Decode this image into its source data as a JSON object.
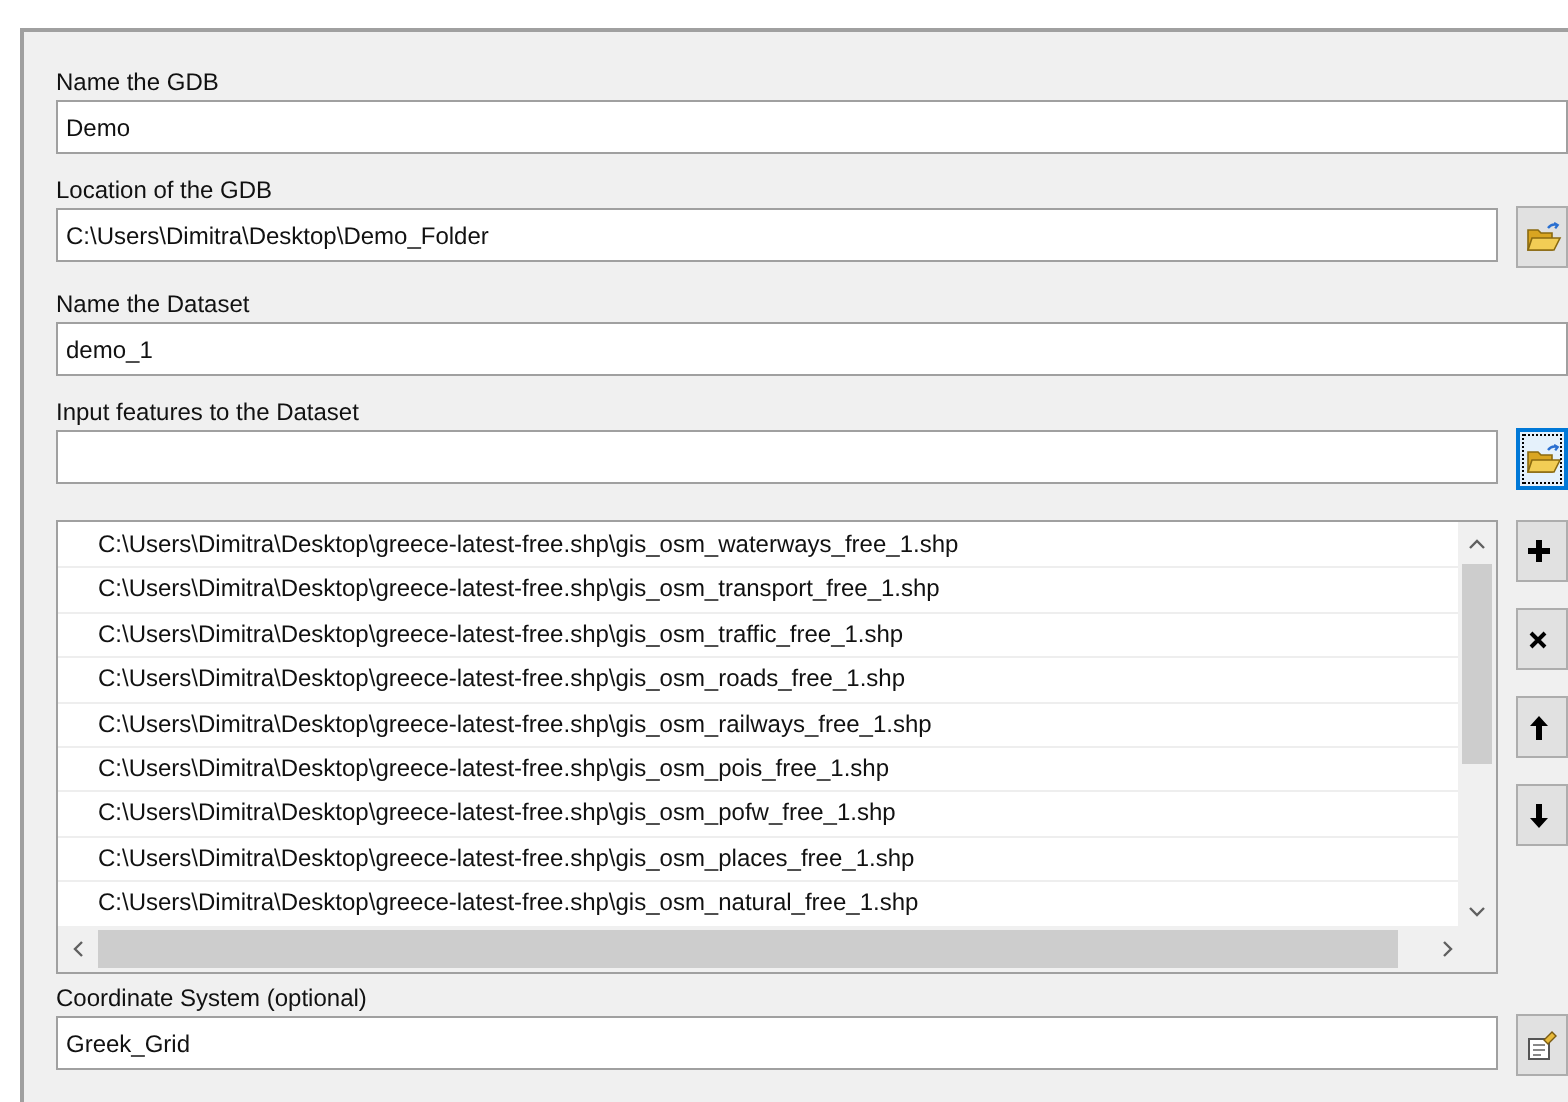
{
  "fields": [
    {
      "label": "Name the GDB",
      "value": "Demo",
      "kind": "text"
    },
    {
      "label": "Location of the GDB",
      "value": "C:\\Users\\Dimitra\\Desktop\\Demo_Folder",
      "kind": "browse",
      "focused": false
    },
    {
      "label": "Name the Dataset",
      "value": "demo_1",
      "kind": "text"
    },
    {
      "label": "Input features to the Dataset",
      "kind": "browse",
      "focused": true
    }
  ],
  "features_list": {
    "items": [
      "C:\\Users\\Dimitra\\Desktop\\greece-latest-free.shp\\gis_osm_waterways_free_1.shp",
      "C:\\Users\\Dimitra\\Desktop\\greece-latest-free.shp\\gis_osm_transport_free_1.shp",
      "C:\\Users\\Dimitra\\Desktop\\greece-latest-free.shp\\gis_osm_traffic_free_1.shp",
      "C:\\Users\\Dimitra\\Desktop\\greece-latest-free.shp\\gis_osm_roads_free_1.shp",
      "C:\\Users\\Dimitra\\Desktop\\greece-latest-free.shp\\gis_osm_railways_free_1.shp",
      "C:\\Users\\Dimitra\\Desktop\\greece-latest-free.shp\\gis_osm_pois_free_1.shp",
      "C:\\Users\\Dimitra\\Desktop\\greece-latest-free.shp\\gis_osm_pofw_free_1.shp",
      "C:\\Users\\Dimitra\\Desktop\\greece-latest-free.shp\\gis_osm_places_free_1.shp",
      "C:\\Users\\Dimitra\\Desktop\\greece-latest-free.shp\\gis_osm_natural_free_1.shp"
    ]
  },
  "coordinate_system": {
    "label": "Coordinate System (optional)",
    "value": "Greek_Grid"
  }
}
